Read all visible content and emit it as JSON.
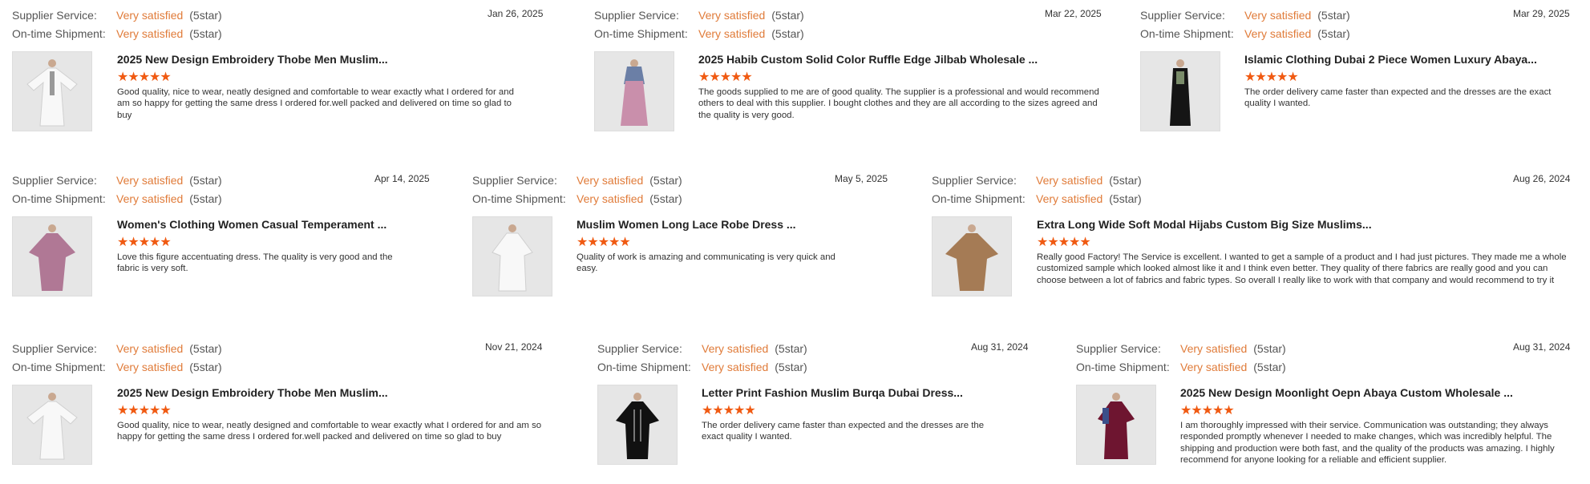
{
  "labels": {
    "supplier_service": "Supplier Service:",
    "on_time_shipment": "On-time Shipment:"
  },
  "colors": {
    "satisfied": "#e07b39",
    "star": "#f05a12"
  },
  "reviews": [
    {
      "date": "Jan 26, 2025",
      "supplier_rating": "Very satisfied",
      "supplier_stars": "(5star)",
      "shipment_rating": "Very satisfied",
      "shipment_stars": "(5star)",
      "product_title": "2025 New Design Embroidery Thobe Men Muslim...",
      "stars": "★★★★★",
      "review_text": "Good quality, nice to wear, neatly designed and comfortable to wear exactly what I ordered for and am so happy for getting the same dress I ordered for.well packed and delivered on time so glad to buy",
      "thumb_icon": "white-abaya-image"
    },
    {
      "date": "Mar 22, 2025",
      "supplier_rating": "Very satisfied",
      "supplier_stars": "(5star)",
      "shipment_rating": "Very satisfied",
      "shipment_stars": "(5star)",
      "product_title": "2025 Habib Custom Solid Color Ruffle Edge Jilbab Wholesale ...",
      "stars": "★★★★★",
      "review_text": "The goods supplied to me are of good quality. The supplier is a professional and would recommend others to deal with this supplier. I bought clothes and they are all according to the sizes agreed and the quality is very good.",
      "thumb_icon": "pink-jilbab-image"
    },
    {
      "date": "Mar 29, 2025",
      "supplier_rating": "Very satisfied",
      "supplier_stars": "(5star)",
      "shipment_rating": "Very satisfied",
      "shipment_stars": "(5star)",
      "product_title": "Islamic Clothing Dubai 2 Piece Women Luxury Abaya...",
      "stars": "★★★★★",
      "review_text": "The order delivery came faster than expected and the dresses are the exact quality I wanted.",
      "thumb_icon": "black-abaya-image"
    },
    {
      "date": "Apr 14, 2025",
      "supplier_rating": "Very satisfied",
      "supplier_stars": "(5star)",
      "shipment_rating": "Very satisfied",
      "shipment_stars": "(5star)",
      "product_title": "Women's Clothing Women Casual Temperament ...",
      "stars": "★★★★★",
      "review_text": "Love this figure accentuating dress. The quality is very good and the fabric is very soft.",
      "thumb_icon": "mauve-dress-image"
    },
    {
      "date": "May 5, 2025",
      "supplier_rating": "Very satisfied",
      "supplier_stars": "(5star)",
      "shipment_rating": "Very satisfied",
      "shipment_stars": "(5star)",
      "product_title": "Muslim Women Long Lace Robe Dress ...",
      "stars": "★★★★★",
      "review_text": "Quality of work is amazing and communicating is very quick and easy.",
      "thumb_icon": "white-lace-robe-image"
    },
    {
      "date": "Aug 26, 2024",
      "supplier_rating": "Very satisfied",
      "supplier_stars": "(5star)",
      "shipment_rating": "Very satisfied",
      "shipment_stars": "(5star)",
      "product_title": "Extra Long Wide Soft Modal Hijabs Custom Big Size Muslims...",
      "stars": "★★★★★",
      "review_text": "Really good Factory! The Service is excellent. I wanted to get a sample of a product and I had just pictures. They made me a whole customized sample which looked almost like it and I think even better. They quality of there fabrics are really good and you can choose between a lot of fabrics and fabric types. So overall I really like to work with that company and would recommend to try it",
      "thumb_icon": "camel-kaftan-image"
    },
    {
      "date": "Nov 21, 2024",
      "supplier_rating": "Very satisfied",
      "supplier_stars": "(5star)",
      "shipment_rating": "Very satisfied",
      "shipment_stars": "(5star)",
      "product_title": "2025 New Design Embroidery Thobe Men Muslim...",
      "stars": "★★★★★",
      "review_text": "Good quality, nice to wear, neatly designed and comfortable to wear exactly what I ordered for and am so happy for getting the same dress I ordered for.well packed and delivered on time so glad to buy",
      "thumb_icon": "white-abaya-image"
    },
    {
      "date": "Aug 31, 2024",
      "supplier_rating": "Very satisfied",
      "supplier_stars": "(5star)",
      "shipment_rating": "Very satisfied",
      "shipment_stars": "(5star)",
      "product_title": "Letter Print Fashion Muslim Burqa Dubai Dress...",
      "stars": "★★★★★",
      "review_text": "The order delivery came faster than expected and the dresses are the exact quality I wanted.",
      "thumb_icon": "black-burqa-image"
    },
    {
      "date": "Aug 31, 2024",
      "supplier_rating": "Very satisfied",
      "supplier_stars": "(5star)",
      "shipment_rating": "Very satisfied",
      "shipment_stars": "(5star)",
      "product_title": "2025 New Design Moonlight Oepn Abaya Custom Wholesale ...",
      "stars": "★★★★★",
      "review_text": "I am thoroughly impressed with their service. Communication was outstanding; they always responded promptly whenever I needed to make changes, which was incredibly helpful. The shipping and production were both fast, and the quality of the products was amazing. I highly recommend for anyone looking for a reliable and efficient supplier.",
      "thumb_icon": "maroon-abaya-image"
    }
  ]
}
